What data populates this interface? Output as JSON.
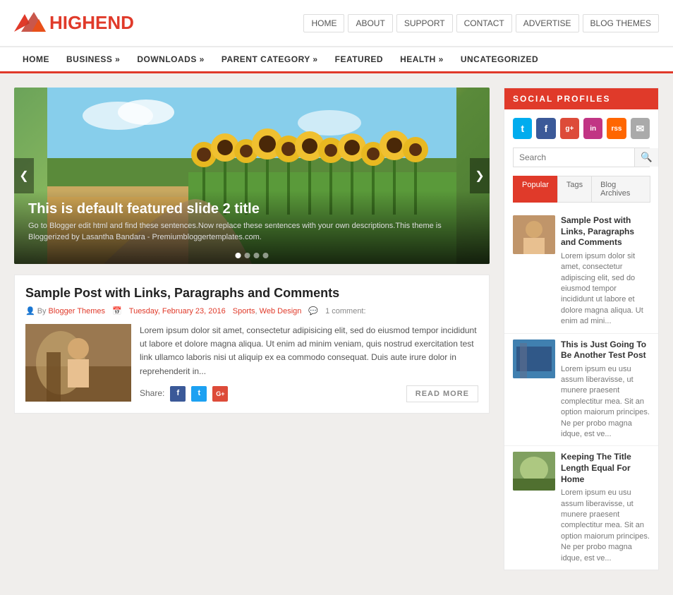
{
  "logo": {
    "text_black": "HIGH",
    "text_red": "END"
  },
  "top_nav": {
    "items": [
      {
        "label": "HOME",
        "key": "home"
      },
      {
        "label": "ABOUT",
        "key": "about"
      },
      {
        "label": "SUPPORT",
        "key": "support"
      },
      {
        "label": "CONTACT",
        "key": "contact"
      },
      {
        "label": "ADVERTISE",
        "key": "advertise"
      },
      {
        "label": "BLOG THEMES",
        "key": "blog-themes"
      }
    ]
  },
  "main_nav": {
    "items": [
      {
        "label": "HOME",
        "key": "home"
      },
      {
        "label": "BUSINESS »",
        "key": "business"
      },
      {
        "label": "DOWNLOADS »",
        "key": "downloads"
      },
      {
        "label": "PARENT CATEGORY »",
        "key": "parent-category"
      },
      {
        "label": "FEATURED",
        "key": "featured"
      },
      {
        "label": "HEALTH »",
        "key": "health"
      },
      {
        "label": "UNCATEGORIZED",
        "key": "uncategorized"
      }
    ]
  },
  "slider": {
    "title": "This is default featured slide 2 title",
    "description": "Go to Blogger edit html and find these sentences.Now replace these sentences with your own descriptions.This theme is Bloggerized by Lasantha Bandara - Premiumbloggertemplates.com.",
    "dots": 4,
    "active_dot": 1
  },
  "article": {
    "title": "Sample Post with Links, Paragraphs and Comments",
    "author": "Blogger Themes",
    "date": "Tuesday, February 23, 2016",
    "tags": [
      "Sports",
      "Web Design"
    ],
    "comments": "1 comment:",
    "body": "Lorem ipsum dolor sit amet, consectetur adipisicing elit, sed do eiusmod tempor incididunt ut labore et dolore magna aliqua. Ut enim ad minim veniam, quis nostrud exercitation  test link ullamco laboris nisi ut aliquip ex ea commodo consequat. Duis aute irure dolor in reprehenderit in...",
    "share_label": "Share:",
    "read_more": "READ MORE"
  },
  "sidebar": {
    "social_header": "SOCIAL PROFILES",
    "social_icons": [
      {
        "name": "twitter",
        "symbol": "t"
      },
      {
        "name": "facebook",
        "symbol": "f"
      },
      {
        "name": "google-plus",
        "symbol": "g+"
      },
      {
        "name": "instagram",
        "symbol": "in"
      },
      {
        "name": "rss",
        "symbol": "rss"
      },
      {
        "name": "email",
        "symbol": "✉"
      }
    ],
    "search_placeholder": "Search",
    "tabs": [
      "Popular",
      "Tags",
      "Blog Archives"
    ],
    "active_tab": 0,
    "posts": [
      {
        "title": "Sample Post with Links, Paragraphs and Comments",
        "desc": "Lorem ipsum dolor sit amet, consectetur adipiscing elit, sed do eiusmod tempor incididunt ut labore et dolore magna aliqua. Ut enim ad mini...",
        "thumb_class": "sp-thumb-1"
      },
      {
        "title": "This is Just Going To Be Another Test Post",
        "desc": "Lorem ipsum eu usu assum liberavisse, ut munere praesent complectitur mea. Sit an option maiorum principes. Ne per probo magna idque, est ve...",
        "thumb_class": "sp-thumb-2"
      },
      {
        "title": "Keeping The Title Length Equal For Home",
        "desc": "Lorem ipsum eu usu assum liberavisse, ut munere praesent complectitur mea. Sit an option maiorum principes. Ne per probo magna idque, est ve...",
        "thumb_class": "sp-thumb-3"
      }
    ]
  }
}
